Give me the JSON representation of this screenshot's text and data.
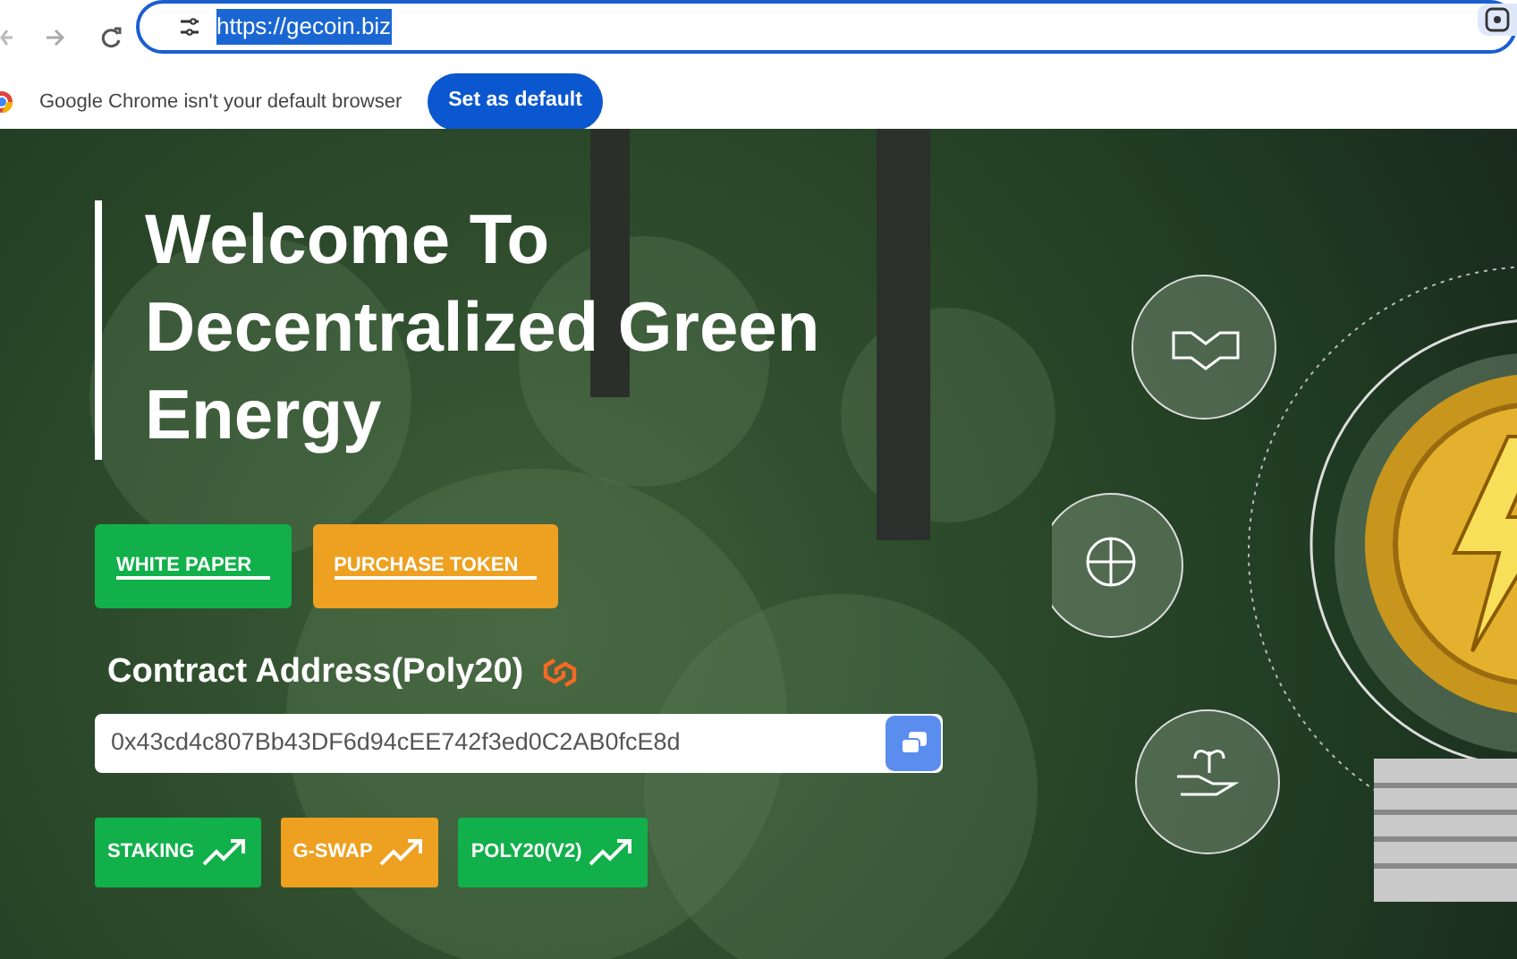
{
  "browser": {
    "url": "https://gecoin.biz",
    "url_selected": true
  },
  "infobar": {
    "message": "Google Chrome isn't your default browser",
    "button": "Set as default"
  },
  "hero": {
    "title": "Welcome To Decentralized Green Energy",
    "primary_buttons": [
      {
        "label": "WHITE PAPER",
        "color": "#12b04a"
      },
      {
        "label": "PURCHASE TOKEN",
        "color": "#eea021"
      }
    ],
    "contract_label": "Contract Address(Poly20)",
    "contract_address": "0x43cd4c807Bb43DF6d94cEE742f3ed0C2AB0fcE8d",
    "links": [
      {
        "label": "STAKING",
        "color": "#12b04a"
      },
      {
        "label": "G-SWAP",
        "color": "#eea021"
      },
      {
        "label": "POLY20(V2)",
        "color": "#12b04a"
      }
    ]
  }
}
